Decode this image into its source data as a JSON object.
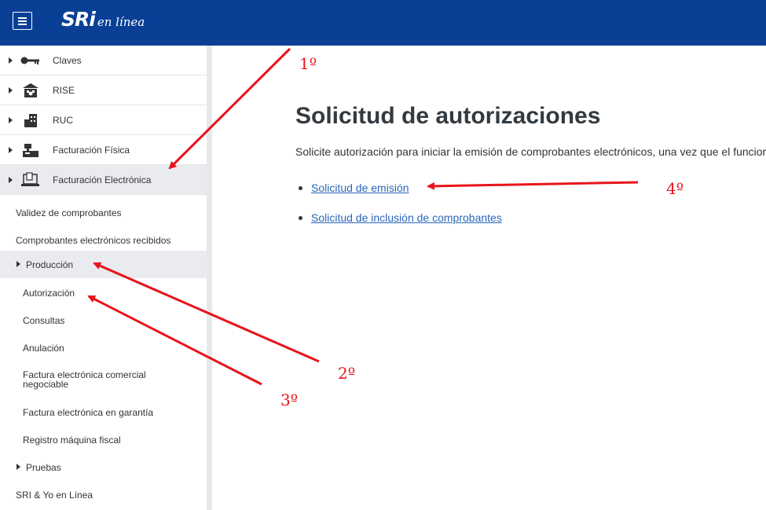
{
  "header": {
    "logo_main": "SRi",
    "logo_sub": "en línea"
  },
  "sidebar": {
    "sections": [
      {
        "label": "Claves",
        "icon": "key-icon"
      },
      {
        "label": "RISE",
        "icon": "building-icon"
      },
      {
        "label": "RUC",
        "icon": "office-icon"
      },
      {
        "label": "Facturación Física",
        "icon": "cash-register-icon"
      },
      {
        "label": "Facturación Electrónica",
        "icon": "laptop-invoice-icon",
        "active": true
      }
    ],
    "items": [
      {
        "label": "Validez de comprobantes"
      },
      {
        "label": "Comprobantes electrónicos recibidos"
      },
      {
        "label": "Producción",
        "expandable": true,
        "active": true
      },
      {
        "label": "Autorización"
      },
      {
        "label": "Consultas"
      },
      {
        "label": "Anulación"
      },
      {
        "label": "Factura electrónica comercial negociable"
      },
      {
        "label": "Factura electrónica en garantía"
      },
      {
        "label": "Registro máquina fiscal"
      },
      {
        "label": "Pruebas",
        "expandable": true
      },
      {
        "label": "SRI & Yo en Línea"
      }
    ]
  },
  "main": {
    "title": "Solicitud de autorizaciones",
    "description": "Solicite autorización para iniciar la emisión de comprobantes electrónicos, una vez que el funcior",
    "links": [
      {
        "label": "Solicitud de emisión"
      },
      {
        "label": "Solicitud de inclusión de comprobantes"
      }
    ]
  },
  "annotations": {
    "step1": "1º",
    "step2": "2º",
    "step3": "3º",
    "step4": "4º",
    "arrow_color": "#e8141b"
  }
}
